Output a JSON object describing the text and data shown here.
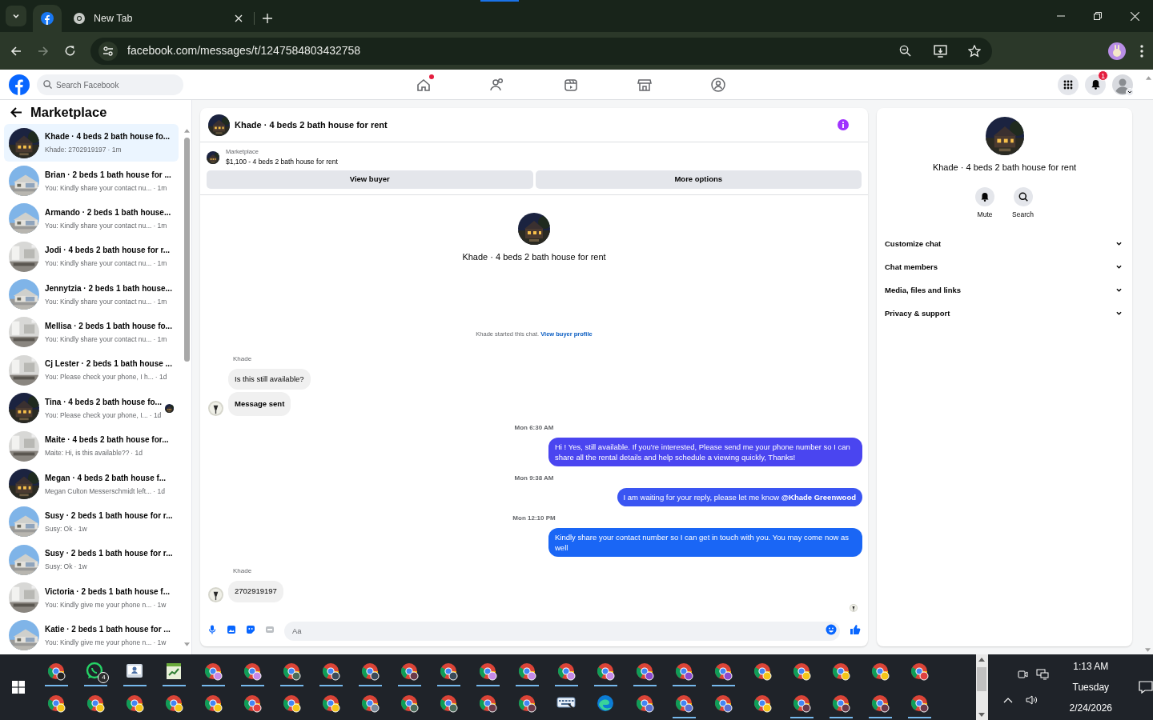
{
  "browser": {
    "tabs": [
      {
        "kind": "facebook",
        "selected": true
      },
      {
        "kind": "chrome",
        "title": "New Tab",
        "selected": false
      }
    ],
    "url": "facebook.com/messages/t/1247584803432758"
  },
  "header": {
    "search_placeholder": "Search Facebook",
    "nav": [
      {
        "kind": "home",
        "dot": true
      },
      {
        "kind": "friends",
        "dot": false
      },
      {
        "kind": "video",
        "dot": false
      },
      {
        "kind": "marketplace",
        "dot": false
      },
      {
        "kind": "groups",
        "dot": false
      }
    ],
    "notification_count": "1"
  },
  "sidebar": {
    "title": "Marketplace",
    "conversations": [
      {
        "title": "Khade · 4 beds 2 bath house fo...",
        "preview": "Khade: 2702919197",
        "time": "· 1m",
        "selected": true,
        "seen": false
      },
      {
        "title": "Brian · 2 beds 1 bath house for ...",
        "preview": "You: Kindly share your contact nu...",
        "time": "· 1m",
        "selected": false,
        "seen": false
      },
      {
        "title": "Armando · 2 beds 1 bath house...",
        "preview": "You: Kindly share your contact nu...",
        "time": "· 1m",
        "selected": false,
        "seen": false
      },
      {
        "title": "Jodi · 4 beds 2 bath house for r...",
        "preview": "You: Kindly share your contact nu...",
        "time": "· 1m",
        "selected": false,
        "seen": false
      },
      {
        "title": "Jennytzia · 2 beds 1 bath house...",
        "preview": "You: Kindly share your contact nu...",
        "time": "· 1m",
        "selected": false,
        "seen": false
      },
      {
        "title": "Mellisa · 2 beds 1 bath house fo...",
        "preview": "You: Kindly share your contact nu...",
        "time": "· 1m",
        "selected": false,
        "seen": false
      },
      {
        "title": "Cj Lester · 2 beds 1 bath house ...",
        "preview": "You: Please check your phone, I h...",
        "time": "· 1d",
        "selected": false,
        "seen": false
      },
      {
        "title": "Tina · 4 beds 2 bath house fo...",
        "preview": "You: Please check your phone, I...",
        "time": "· 1d",
        "selected": false,
        "seen": true
      },
      {
        "title": "Maite · 4 beds 2 bath house for...",
        "preview": "Maite: Hi, is this available??",
        "time": "· 1d",
        "selected": false,
        "seen": false
      },
      {
        "title": "Megan · 4 beds 2 bath house f...",
        "preview": "Megan Culton Messerschmidt left...",
        "time": "· 1d",
        "selected": false,
        "seen": false
      },
      {
        "title": "Susy · 2 beds 1 bath house for r...",
        "preview": "Susy: Ok",
        "time": "· 1w",
        "selected": false,
        "seen": false
      },
      {
        "title": "Susy · 2 beds 1 bath house for r...",
        "preview": "Susy: Ok",
        "time": "· 1w",
        "selected": false,
        "seen": false
      },
      {
        "title": "Victoria · 2 beds 1 bath house f...",
        "preview": "You: Kindly give me your phone n...",
        "time": "· 1w",
        "selected": false,
        "seen": false
      },
      {
        "title": "Katie · 2 beds 1 bath house for ...",
        "preview": "You: Kindly give me your phone n...",
        "time": "· 1w",
        "selected": false,
        "seen": false
      }
    ]
  },
  "chat": {
    "title": "Khade · 4 beds 2 bath house for rent",
    "listing": {
      "label": "Marketplace",
      "title": "$1,100 - 4 beds 2 bath house for rent"
    },
    "buttons": [
      "View buyer",
      "More options"
    ],
    "intro_name": "Khade · 4 beds 2 bath house for rent",
    "started": {
      "text": "Khade started this chat.",
      "link": "View buyer profile"
    },
    "messages": [
      {
        "kind": "sender",
        "text": "Khade"
      },
      {
        "kind": "incoming",
        "text": "Is this still available?",
        "avatar": false,
        "bold": false
      },
      {
        "kind": "incoming",
        "text": "Message sent",
        "avatar": true,
        "bold": true
      },
      {
        "kind": "timestamp",
        "text": "Mon 6:30 AM"
      },
      {
        "kind": "outgoing",
        "text": "Hi ! Yes, still available. If you're interested, Please send me your phone number so I can share all the rental details and help schedule a viewing quickly, Thanks!",
        "color": "#4a45f0"
      },
      {
        "kind": "timestamp",
        "text": "Mon 9:38 AM"
      },
      {
        "kind": "outgoing",
        "text": "I am waiting for your reply, please let me know **@Khade Greenwood**",
        "color": "#3a55f2"
      },
      {
        "kind": "timestamp",
        "text": "Mon 12:10 PM"
      },
      {
        "kind": "outgoing",
        "text": "Kindly share your contact number so I can get in touch with you. You may come now as well",
        "color": "#1a66f5"
      },
      {
        "kind": "sender",
        "text": "Khade"
      },
      {
        "kind": "incoming",
        "text": "2702919197",
        "avatar": true,
        "bold": false
      }
    ],
    "seen": true,
    "composer_placeholder": "Aa"
  },
  "details": {
    "name": "Khade · 4 beds 2 bath house for rent",
    "actions": [
      {
        "kind": "bell",
        "label": "Mute"
      },
      {
        "kind": "search",
        "label": "Search"
      }
    ],
    "sections": [
      "Customize chat",
      "Chat members",
      "Media, files and links",
      "Privacy & support"
    ]
  },
  "taskbar": {
    "rows": [
      [
        {
          "kind": "chrome",
          "color": "#222222",
          "open": true
        },
        {
          "kind": "whatsapp",
          "badge": "4",
          "open": true
        },
        {
          "kind": "app",
          "open": true
        },
        {
          "kind": "notepad",
          "open": true
        },
        {
          "kind": "chrome",
          "color": "#c58ae8",
          "open": true
        },
        {
          "kind": "chrome",
          "color": "#c58ae8",
          "open": true
        },
        {
          "kind": "chrome",
          "color": "#4a6b5a",
          "open": true
        },
        {
          "kind": "chrome",
          "color": "#3a4a5a",
          "open": true
        },
        {
          "kind": "chrome",
          "color": "#3a4a5a",
          "open": true
        },
        {
          "kind": "chrome",
          "color": "#6a3a4a",
          "open": true
        },
        {
          "kind": "chrome",
          "color": "#3a4a5a",
          "open": true
        },
        {
          "kind": "chrome",
          "color": "#c58ae8",
          "open": true
        },
        {
          "kind": "chrome",
          "color": "#c58ae8",
          "open": true
        },
        {
          "kind": "chrome",
          "color": "#c58ae8",
          "open": true
        },
        {
          "kind": "chrome",
          "color": "#c58ae8",
          "open": true
        },
        {
          "kind": "chrome",
          "color": "#8a4ad0",
          "open": true
        },
        {
          "kind": "chrome",
          "color": "#8a4ad0",
          "open": true
        },
        {
          "kind": "chrome",
          "color": "#8a4ad0",
          "open": true
        },
        {
          "kind": "chrome",
          "color": "#f5c518",
          "open": false
        },
        {
          "kind": "chrome",
          "color": "#f5c518",
          "open": false
        },
        {
          "kind": "chrome",
          "color": "#f5c518",
          "open": false
        },
        {
          "kind": "chrome",
          "color": "#f5c518",
          "open": false
        },
        {
          "kind": "chrome",
          "color": "#e04040",
          "open": false
        }
      ],
      [
        {
          "kind": "chrome",
          "color": "#f5c518",
          "open": false
        },
        {
          "kind": "chrome",
          "color": "#f5c518",
          "open": false
        },
        {
          "kind": "chrome",
          "color": "#f5c518",
          "open": false
        },
        {
          "kind": "chrome",
          "color": "#f5c518",
          "open": false
        },
        {
          "kind": "chrome",
          "color": "#f5c518",
          "open": false
        },
        {
          "kind": "chrome",
          "color": "#e04040",
          "open": false
        },
        {
          "kind": "chrome",
          "color": "#f5c518",
          "open": false
        },
        {
          "kind": "chrome",
          "color": "#f5c518",
          "open": false
        },
        {
          "kind": "chrome",
          "color": "#7a8a9a",
          "open": false
        },
        {
          "kind": "chrome",
          "color": "#4a6b5a",
          "open": false
        },
        {
          "kind": "chrome",
          "color": "#4a6b5a",
          "open": false
        },
        {
          "kind": "chrome",
          "color": "#6a3a4a",
          "open": false
        },
        {
          "kind": "chrome",
          "color": "#6a3a4a",
          "open": false
        },
        {
          "kind": "keyboard",
          "open": false
        },
        {
          "kind": "edge",
          "open": false
        },
        {
          "kind": "chrome",
          "color": "#5a70d0",
          "open": false
        },
        {
          "kind": "chrome",
          "color": "#5a70d0",
          "open": true
        },
        {
          "kind": "chrome",
          "color": "#5a70d0",
          "open": false
        },
        {
          "kind": "chrome",
          "color": "#f5c518",
          "open": false
        },
        {
          "kind": "chrome",
          "color": "#6a3a4a",
          "open": true
        },
        {
          "kind": "chrome",
          "color": "#6a3a4a",
          "open": true
        },
        {
          "kind": "chrome",
          "color": "#6a3a4a",
          "open": true
        },
        {
          "kind": "chrome",
          "color": "#6a3a4a",
          "open": true
        }
      ]
    ],
    "time": "1:13 AM",
    "day": "Tuesday",
    "date": "2/24/2026"
  }
}
